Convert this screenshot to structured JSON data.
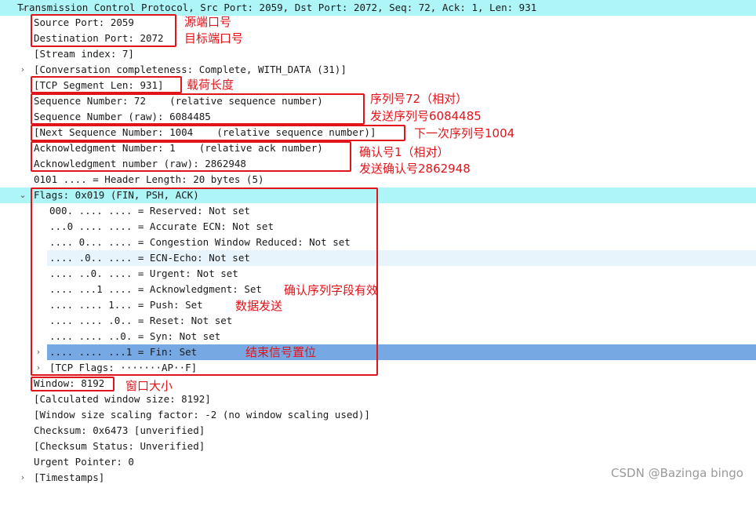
{
  "tree": {
    "header": "Transmission Control Protocol, Src Port: 2059, Dst Port: 2072, Seq: 72, Ack: 1, Len: 931",
    "src_port": "Source Port: 2059",
    "dst_port": "Destination Port: 2072",
    "stream": "[Stream index: 7]",
    "conversation": "[Conversation completeness: Complete, WITH_DATA (31)]",
    "seg_len": "[TCP Segment Len: 931]",
    "seq": "Sequence Number: 72    (relative sequence number)",
    "seq_raw": "Sequence Number (raw): 6084485",
    "next_seq": "[Next Sequence Number: 1004    (relative sequence number)]",
    "ack": "Acknowledgment Number: 1    (relative ack number)",
    "ack_raw": "Acknowledgment number (raw): 2862948",
    "hdr_len": "0101 .... = Header Length: 20 bytes (5)",
    "flags": "Flags: 0x019 (FIN, PSH, ACK)",
    "flag_reserved": "000. .... .... = Reserved: Not set",
    "flag_accecn": "...0 .... .... = Accurate ECN: Not set",
    "flag_cwr": ".... 0... .... = Congestion Window Reduced: Not set",
    "flag_ecn": ".... .0.. .... = ECN-Echo: Not set",
    "flag_urg": ".... ..0. .... = Urgent: Not set",
    "flag_ack": ".... ...1 .... = Acknowledgment: Set",
    "flag_psh": ".... .... 1... = Push: Set",
    "flag_rst": ".... .... .0.. = Reset: Not set",
    "flag_syn": ".... .... ..0. = Syn: Not set",
    "flag_fin": ".... .... ...1 = Fin: Set",
    "tcp_flags": "[TCP Flags: ·······AP··F]",
    "window": "Window: 8192",
    "calc_window": "[Calculated window size: 8192]",
    "scaling": "[Window size scaling factor: -2 (no window scaling used)]",
    "checksum": "Checksum: 0x6473 [unverified]",
    "checksum_status": "[Checksum Status: Unverified]",
    "urgent_ptr": "Urgent Pointer: 0",
    "timestamps": "[Timestamps]"
  },
  "annotations": {
    "src_port": "源端口号",
    "dst_port": "目标端口号",
    "seg_len": "载荷长度",
    "seq": "序列号72（相对）",
    "seq_raw": "发送序列号6084485",
    "next_seq": "下一次序列号1004",
    "ack": "确认号1（相对）",
    "ack_raw": "发送确认号2862948",
    "ack_flag": "确认序列字段有效",
    "push": "数据发送",
    "fin": "结束信号置位",
    "window": "窗口大小"
  },
  "icons": {
    "expanded": "chevron-down-icon",
    "collapsed": "chevron-right-icon"
  },
  "colors": {
    "highlight": "#aef5f7",
    "selected": "#76a8e4",
    "annotation": "#e0141b"
  },
  "watermark": "CSDN @Bazinga bingo"
}
